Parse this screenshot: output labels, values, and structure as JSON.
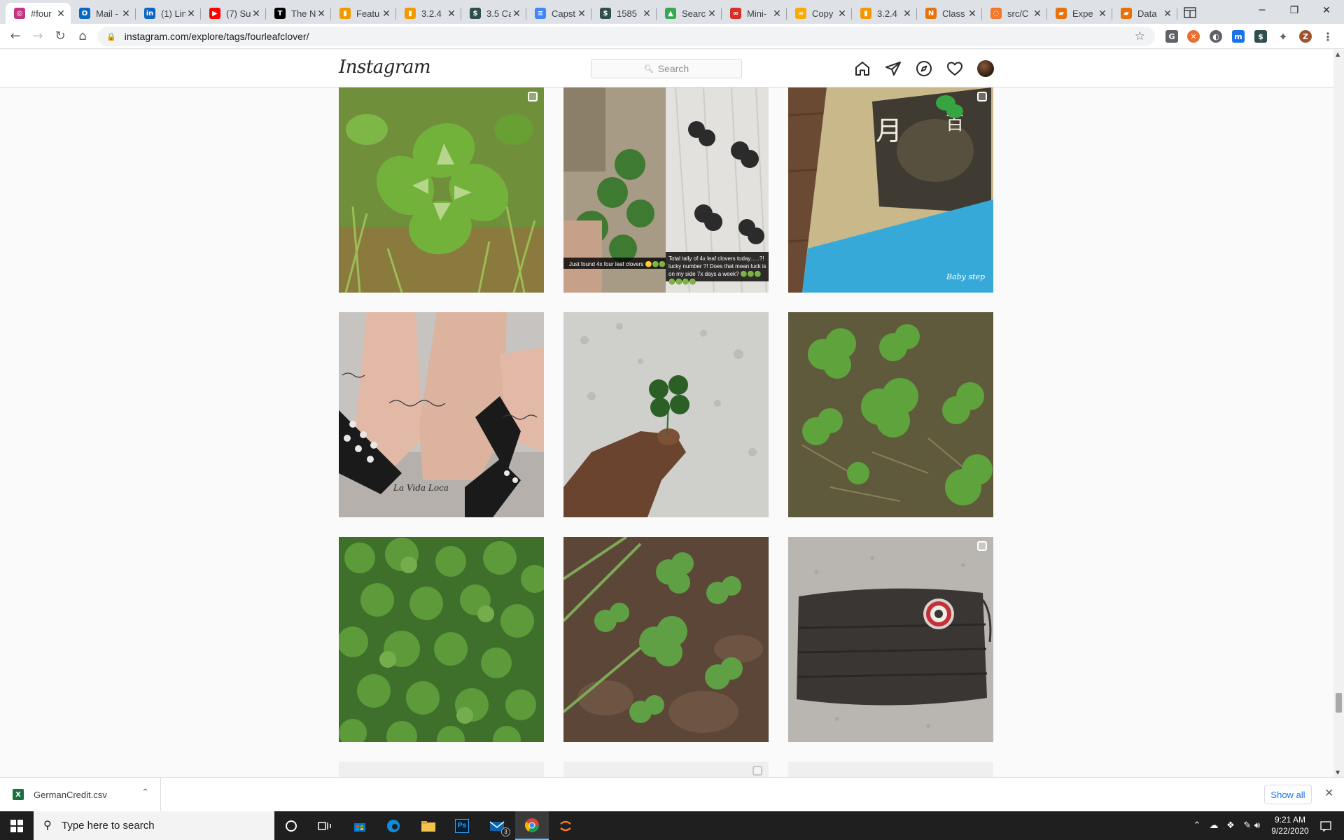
{
  "browser": {
    "tabs": [
      {
        "title": "#four",
        "icon": "instagram-icon",
        "color": "#c13584",
        "glyph": "◎",
        "active": true
      },
      {
        "title": "Mail -",
        "icon": "outlook-icon",
        "color": "#0a66c2",
        "glyph": "O"
      },
      {
        "title": "(1) Lin",
        "icon": "linkedin-icon",
        "color": "#0a66c2",
        "glyph": "in"
      },
      {
        "title": "(7) Su",
        "icon": "youtube-icon",
        "color": "#ff0000",
        "glyph": "▶"
      },
      {
        "title": "The N",
        "icon": "nytimes-icon",
        "color": "#000000",
        "glyph": "T"
      },
      {
        "title": "Featu",
        "icon": "chart-icon",
        "color": "#f29900",
        "glyph": "▮"
      },
      {
        "title": "3.2.4",
        "icon": "chart-icon",
        "color": "#f29900",
        "glyph": "▮"
      },
      {
        "title": "3.5 Ca",
        "icon": "doc-icon",
        "color": "#2f4f4f",
        "glyph": "$"
      },
      {
        "title": "Capst",
        "icon": "gdocs-icon",
        "color": "#4285f4",
        "glyph": "≡"
      },
      {
        "title": "1585",
        "icon": "doc-icon",
        "color": "#2f4f4f",
        "glyph": "$"
      },
      {
        "title": "Searc",
        "icon": "gdrive-icon",
        "color": "#34a853",
        "glyph": "▲"
      },
      {
        "title": "Mini-",
        "icon": "loop-icon",
        "color": "#d93025",
        "glyph": "∞"
      },
      {
        "title": "Copy",
        "icon": "copy-icon",
        "color": "#f9ab00",
        "glyph": "∞"
      },
      {
        "title": "3.2.4",
        "icon": "chart-icon",
        "color": "#f29900",
        "glyph": "▮"
      },
      {
        "title": "Class",
        "icon": "notebook-icon",
        "color": "#e8710a",
        "glyph": "N"
      },
      {
        "title": "src/C",
        "icon": "jupyter-icon",
        "color": "#f37726",
        "glyph": "◌"
      },
      {
        "title": "Expe",
        "icon": "book-icon",
        "color": "#e8710a",
        "glyph": "▰"
      },
      {
        "title": "Data",
        "icon": "book-icon",
        "color": "#e8710a",
        "glyph": "▰"
      }
    ],
    "close_glyph": "✕",
    "url": "instagram.com/explore/tags/fourleafclover/",
    "profile_initial": "Z"
  },
  "instagram": {
    "logo": "Instagram",
    "search_placeholder": "Search"
  },
  "posts": [
    {
      "name": "post-clover-grass",
      "multi": true
    },
    {
      "name": "post-clover-collage",
      "multi": false,
      "caption_left": "Just found 4x four leaf clovers 🟡🟢🟢",
      "caption_right": "Total tally of 4x leaf clovers today…..?! lucky number ?! Does that mean luck is on my side 7x days a week? 🟢🟢🟢🟢🟢🟢🟢"
    },
    {
      "name": "post-book-cover",
      "multi": true,
      "book_text": "Baby step"
    },
    {
      "name": "post-ankle-tattoo",
      "multi": false,
      "tattoo_text": "La Vida Loca"
    },
    {
      "name": "post-hand-clover",
      "multi": false
    },
    {
      "name": "post-clover-patch",
      "multi": false
    },
    {
      "name": "post-clover-field",
      "multi": false
    },
    {
      "name": "post-clover-leaves",
      "multi": false
    },
    {
      "name": "post-face-mask",
      "multi": true
    }
  ],
  "downloads": {
    "file": "GermanCredit.csv",
    "show_all": "Show all"
  },
  "taskbar": {
    "search_placeholder": "Type here to search",
    "mail_badge": "3",
    "time": "9:21 AM",
    "date": "9/22/2020"
  }
}
